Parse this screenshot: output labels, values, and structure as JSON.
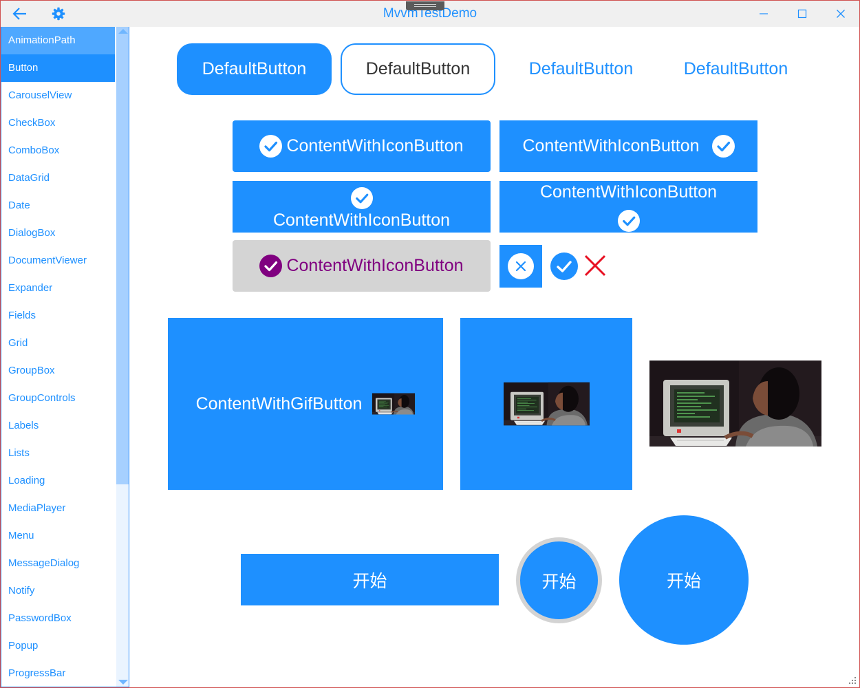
{
  "window": {
    "title": "MvvmTestDemo"
  },
  "titlebar_icons": {
    "back": "arrow-left-icon",
    "settings": "gear-icon",
    "minimize": "minimize-icon",
    "maximize": "maximize-icon",
    "close": "close-icon"
  },
  "sidebar": {
    "items": [
      {
        "label": "AnimationPath"
      },
      {
        "label": "Button"
      },
      {
        "label": "CarouselView"
      },
      {
        "label": "CheckBox"
      },
      {
        "label": "ComboBox"
      },
      {
        "label": "DataGrid"
      },
      {
        "label": "Date"
      },
      {
        "label": "DialogBox"
      },
      {
        "label": "DocumentViewer"
      },
      {
        "label": "Expander"
      },
      {
        "label": "Fields"
      },
      {
        "label": "Grid"
      },
      {
        "label": "GroupBox"
      },
      {
        "label": "GroupControls"
      },
      {
        "label": "Labels"
      },
      {
        "label": "Lists"
      },
      {
        "label": "Loading"
      },
      {
        "label": "MediaPlayer"
      },
      {
        "label": "Menu"
      },
      {
        "label": "MessageDialog"
      },
      {
        "label": "Notify"
      },
      {
        "label": "PasswordBox"
      },
      {
        "label": "Popup"
      },
      {
        "label": "ProgressBar"
      }
    ],
    "hover_index": 0,
    "active_index": 1
  },
  "default_buttons": [
    {
      "label": "DefaultButton"
    },
    {
      "label": "DefaultButton"
    },
    {
      "label": "DefaultButton"
    },
    {
      "label": "DefaultButton"
    }
  ],
  "icon_buttons": {
    "left_icon": "ContentWithIconButton",
    "right_icon": "ContentWithIconButton",
    "top_icon": "ContentWithIconButton",
    "bottom_icon": "ContentWithIconButton",
    "disabled": "ContentWithIconButton"
  },
  "gif_buttons": {
    "with_text": "ContentWithGifButton"
  },
  "start_buttons": {
    "rect": "开始",
    "circle_small": "开始",
    "circle_large": "开始"
  },
  "colors": {
    "accent": "#1e90ff",
    "disabled_bg": "#d4d4d4",
    "disabled_fg": "#800080",
    "error": "#e81123"
  }
}
